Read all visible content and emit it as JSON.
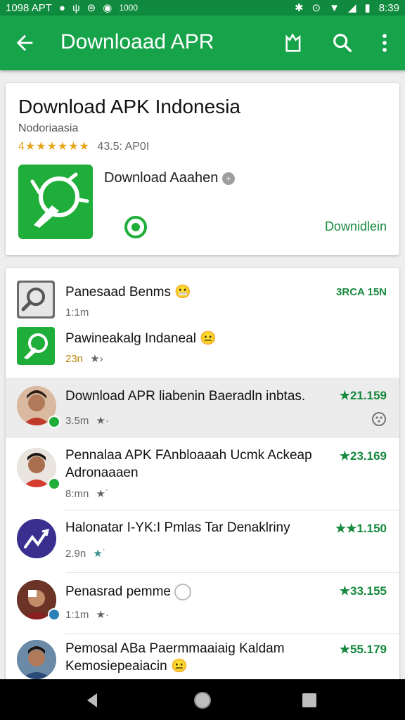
{
  "status_bar": {
    "left_text": "1098 APT",
    "left_extra": "1000",
    "time": "8:39"
  },
  "app_bar": {
    "title": "Downloaad APR"
  },
  "header_card": {
    "title": "Download APK Indonesia",
    "subtitle": "Nodoriaasia",
    "stars": "4★★★★★★",
    "rating_text": "43.5: AP0I",
    "feature_label": "Download Aaahen",
    "download_label": "Downidlein"
  },
  "list": [
    {
      "title": "Panesaad Benms",
      "meta": "1:1m",
      "score": "3RCA 15N",
      "emoji": "😬"
    },
    {
      "title": "Pawineakalg Indaneal",
      "meta": "23n",
      "meta_star": "★›",
      "emoji": "😐"
    },
    {
      "title": "Download APR liabenin Baeradln inbtas.",
      "meta": "3.5m",
      "meta_star": "★·",
      "score": "★21.159"
    },
    {
      "title": "Pennalaa APK FAnbloaaah Ucmk Ackeap",
      "title2": "Adronaaaen",
      "meta": "8:mn",
      "meta_star": "★˙",
      "score": "★23.169"
    },
    {
      "title": "Halonatar I-YK:I Pmlas Tar Denaklriny",
      "meta": "2.9n",
      "meta_star": "★˙",
      "score": "★★1.150"
    },
    {
      "title": "Penasrad pemme",
      "meta": "1:1m",
      "meta_star": "★·",
      "score": "★33.155"
    },
    {
      "title": "Pemosal ABa Paermmaaiaig Kaldam",
      "title2": "Kemosiepeaiacin",
      "score": "★55.179",
      "emoji": "😐"
    }
  ],
  "colors": {
    "primary": "#17a34a",
    "status": "#0f8a3e",
    "accent": "#16893e",
    "star": "#e8a317"
  }
}
